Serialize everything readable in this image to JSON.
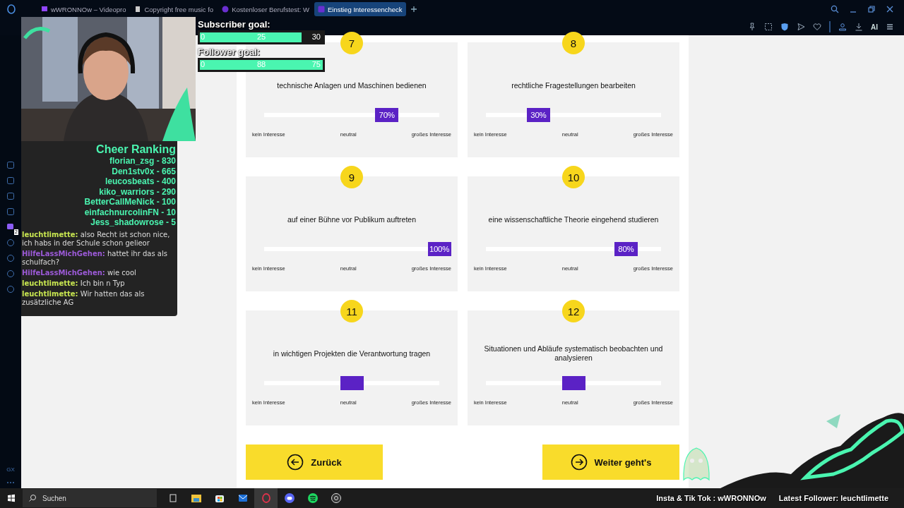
{
  "browser": {
    "tabs": [
      {
        "label": "wWRONNOw – Videopro",
        "kind": "stream",
        "selected": false
      },
      {
        "label": "Copyright free music fo",
        "kind": "document",
        "selected": false
      },
      {
        "label": "Kostenloser Berufstest: W",
        "kind": "circle",
        "selected": false
      },
      {
        "label": "Einstieg Interessencheck",
        "kind": "square",
        "selected": true
      }
    ],
    "toolbar_label": "AI"
  },
  "sidebar": {
    "badge": "2",
    "logo": "GX"
  },
  "overlay": {
    "subscriber_goal": {
      "title": "Subscriber goal:",
      "start": "0",
      "current": "25",
      "target": "30",
      "level": 0.83
    },
    "follower_goal": {
      "title": "Follower goal:",
      "start": "0",
      "current": "88",
      "target": "75",
      "level": 1
    },
    "cheer_ranking": {
      "title": "Cheer Ranking",
      "entries": [
        "florian_zsg - 830",
        "Den1stv0x - 665",
        "leucosbeats - 400",
        "kiko_warriors - 290",
        "BetterCallMeNick - 100",
        "einfachnurcolinFN - 10",
        "Jess_shadowrose - 5"
      ]
    },
    "chat": [
      {
        "user": "leuchtlimette:",
        "text": "also Recht ist schon nice, ich habs in der Schule schon gelieor",
        "color": "#c8e650"
      },
      {
        "user": "HilfeLassMichGehen:",
        "text": "hattet ihr das als schulfach?",
        "color": "#9c5ad8"
      },
      {
        "user": "HilfeLassMichGehen:",
        "text": "wie cool",
        "color": "#9c5ad8"
      },
      {
        "user": "leuchtlimette:",
        "text": "Ich bin n Typ",
        "color": "#c8e650"
      },
      {
        "user": "leuchtlimette:",
        "text": "Wir hatten das als zusätzliche AG",
        "color": "#c8e650"
      }
    ],
    "footer": [
      "Insta & Tik Tok : wWRONNOw",
      "Latest Follower: leuchtlimette"
    ]
  },
  "questions": [
    {
      "number": "7",
      "text": "technische Anlagen und Maschinen bedienen",
      "level": 0.7,
      "value_label": "70%",
      "scale": [
        "kein Interesse",
        "neutral",
        "großes Interesse"
      ]
    },
    {
      "number": "8",
      "text": "rechtliche Fragestellungen bearbeiten",
      "level": 0.3,
      "value_label": "30%",
      "scale": [
        "kein Interesse",
        "neutral",
        "großes Interesse"
      ]
    },
    {
      "number": "9",
      "text": "auf einer Bühne vor Publikum auftreten",
      "level": 1,
      "value_label": "100%",
      "scale": [
        "kein Interesse",
        "neutral",
        "großes Interesse"
      ]
    },
    {
      "number": "10",
      "text": "eine wissenschaftliche Theorie eingehend studieren",
      "level": 0.8,
      "value_label": "80%",
      "scale": [
        "kein Interesse",
        "neutral",
        "großes Interesse"
      ]
    },
    {
      "number": "11",
      "text": "in wichtigen Projekten die Verantwortung tragen",
      "level": 0.5,
      "scale": [
        "kein Interesse",
        "neutral",
        "großes Interesse"
      ]
    },
    {
      "number": "12",
      "text": "Situationen und Abläufe systematisch beobachten und analysieren",
      "level": 0.5,
      "scale": [
        "kein Interesse",
        "neutral",
        "großes Interesse"
      ]
    }
  ],
  "buttons": {
    "back": "Zurück",
    "next": "Weiter geht's"
  },
  "taskbar": {
    "search": {
      "placeholder": "Suchen"
    },
    "apps": [
      {
        "kind": "taskview",
        "active": false
      },
      {
        "kind": "folder",
        "active": false
      },
      {
        "kind": "store",
        "active": false
      },
      {
        "kind": "mail",
        "active": false
      },
      {
        "kind": "browser",
        "active": true
      },
      {
        "kind": "chat",
        "active": false
      },
      {
        "kind": "music",
        "active": false
      },
      {
        "kind": "recorder",
        "active": false
      }
    ]
  }
}
